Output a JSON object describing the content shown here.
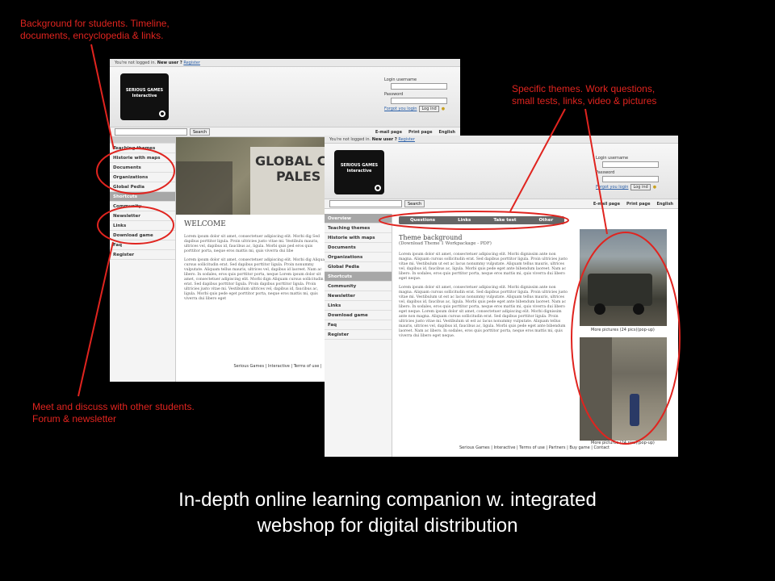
{
  "annotations": {
    "background": [
      "Background for students. Timeline,",
      "documents, encyclopedia & links."
    ],
    "specific": [
      "Specific themes. Work questions,",
      "small tests, links, video & pictures"
    ],
    "community": [
      "Meet and discuss with other students.",
      "Forum & newsletter"
    ]
  },
  "caption": [
    "In-depth online learning companion w. integrated",
    "webshop for digital distribution"
  ],
  "colors": {
    "annotation": "#e0241f",
    "background": "#000000",
    "caption": "#ffffff"
  },
  "site": {
    "topbar": {
      "not_logged": "You're not logged in.",
      "new_user": "New user ?",
      "register": "Register"
    },
    "logo_line1": "SERIOUS GAMES",
    "logo_line2": "Interactive",
    "login": {
      "username": "Login username",
      "password": "Password",
      "forgot": "Forgot you login",
      "button": "Log ind"
    },
    "search_button": "Search",
    "tools": [
      "E-mail page",
      "Print page",
      "English"
    ],
    "footer_back": "Serious Games | Interactive | Terms of use |",
    "footer_front": "Serious Games | Interactive | Terms of use | Partners | Buy game | Contact"
  },
  "back_screen": {
    "nav": [
      "Teaching themes",
      "Historie with maps",
      "Documents",
      "Organizations",
      "Global Pedia",
      "Shortcuts",
      "Community",
      "Newsletter",
      "Links",
      "Download game",
      "Faq",
      "Register"
    ],
    "banner_text": [
      "GLOBAL CO",
      "PALES"
    ],
    "welcome": "WELCOME",
    "lorem": [
      "Lorem ipsum dolor sit amet, consectetuer adipiscing elit. Morbi dig Sed dapibus porttitor ligula. Proin ultricies justo vitae mi. Vestibulu mauris, ultrices vel, dapibus id, faucibus ac, ligula. Morbi quis ped eros quis porttitor porta, neque eros mattis mi, quis viverra dui libe",
      "Lorem ipsum dolor sit amet, consectetuer adipiscing elit. Morbi dig Aliquam cursus sollicitudin erat. Sed dapibus porttitor ligula. Proin nonummy vulputate. Aliquam tellus mauris, ultrices vel, dapibus id laoreet. Nam ac libero. In sodales, eros quis porttitor porta, neque Lorem ipsum dolor sit amet, consectetuer adipiscing elit. Morbi dign Aliquam cursus sollicitudin erat. Sed dapibus porttitor ligula. Proin dapibus porttitor ligula. Proin ultricies justo vitae mi. Vestibulum ultrices vel, dapibus id, faucibus ac, ligula. Morbi quis pede eget porttitor porta, neque eros mattis mi, quis viverra dui libero eget"
    ]
  },
  "front_screen": {
    "nav": [
      "Overview",
      "Teaching themes",
      "Historie with maps",
      "Documents",
      "Organizations",
      "Global Pedia",
      "Shortcuts",
      "Community",
      "Newsletter",
      "Links",
      "Download game",
      "Faq",
      "Register"
    ],
    "tabs": [
      "Questions",
      "Links",
      "Take test",
      "Other"
    ],
    "title": "Theme background",
    "subtitle": "(Download Theme 1 Workpackage - PDF)",
    "lorem": [
      "Lorem ipsum dolor sit amet, consectetuer adipiscing elit. Morbi dignissim ante non magna. Aliquam cursus sollicitudin erat. Sed dapibus porttitor ligula. Proin ultricies justo vitae mi. Vestibulum ut est ac lacus nonummy vulputate. Aliquam tellus mauris, ultrices vel, dapibus id, faucibus ac, ligula. Morbi quis pede eget ante bibendum laoreet. Nam ac libero. In sodales, eros quis porttitor porta, neque eros mattis mi, quis viverra dui libero eget neque.",
      "Lorem ipsum dolor sit amet, consectetuer adipiscing elit. Morbi dignissim ante non magna. Aliquam cursus sollicitudin erat. Sed dapibus porttitor ligula. Proin ultricies justo vitae mi. Vestibulum ut est ac lacus nonummy vulputate. Aliquam tellus mauris, ultrices vel, dapibus id, faucibus ac, ligula. Morbi quis pede eget ante bibendum laoreet. Nam ac libero. In sodales, eros quis porttitor porta, neque eros mattis mi, quis viverra dui libero eget neque. Lorem ipsum dolor sit amet, consectetuer adipiscing elit. Morbi dignissim ante non magna. Aliquam cursus sollicitudin erat. Sed dapibus porttitor ligula. Proin ultricies justo vitae mi. Vestibulum ut est ac lacus nonummy vulputate. Aliquam tellus mauris, ultrices vel, dapibus id, faucibus ac, ligula. Morbi quis pede eget ante bibendum laoreet. Nam ac libero. In sodales, eros quis porttitor porta, neque eros mattis mi, quis viverra dui libero eget neque."
    ],
    "more_pictures": "More pictures (24 pics)(pop-up)"
  }
}
